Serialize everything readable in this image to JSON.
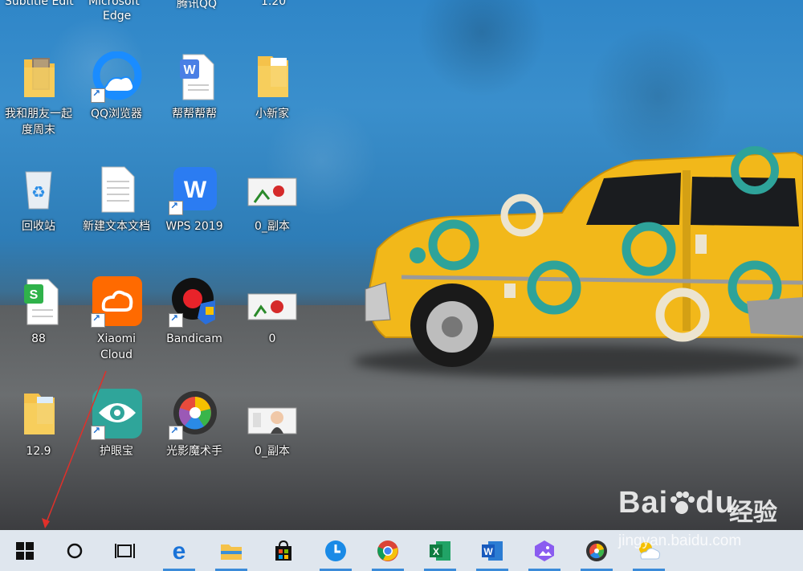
{
  "desktop": {
    "top_partial_labels": [
      "Subtitle Edit",
      "Microsoft",
      "Edge",
      "腾讯QQ",
      "1.20"
    ],
    "icons": [
      {
        "label": "我和朋友一起\n度周末",
        "name": "folder-photos-icon",
        "shortcut": false
      },
      {
        "label": "QQ浏览器",
        "name": "qq-browser-icon",
        "shortcut": true
      },
      {
        "label": "帮帮帮帮",
        "name": "wps-word-document-icon",
        "shortcut": false
      },
      {
        "label": "小新家",
        "name": "folder-document-icon",
        "shortcut": false
      },
      {
        "label": "回收站",
        "name": "recycle-bin-icon",
        "shortcut": false
      },
      {
        "label": "新建文本文档",
        "name": "text-document-icon",
        "shortcut": false
      },
      {
        "label": "WPS 2019",
        "name": "wps-office-icon",
        "shortcut": true
      },
      {
        "label": "0_副本",
        "name": "image-thumbnail-icon",
        "shortcut": false
      },
      {
        "label": "88",
        "name": "spreadsheet-document-icon",
        "shortcut": false
      },
      {
        "label": "Xiaomi\nCloud",
        "name": "xiaomi-cloud-icon",
        "shortcut": true
      },
      {
        "label": "Bandicam",
        "name": "bandicam-icon",
        "shortcut": true
      },
      {
        "label": "0",
        "name": "image-thumbnail-icon",
        "shortcut": false
      },
      {
        "label": "12.9",
        "name": "folder-document-icon",
        "shortcut": false
      },
      {
        "label": "护眼宝",
        "name": "eye-protection-icon",
        "shortcut": true
      },
      {
        "label": "光影魔术手",
        "name": "photo-editor-icon",
        "shortcut": true
      },
      {
        "label": "0_副本",
        "name": "portrait-thumbnail-icon",
        "shortcut": false
      }
    ]
  },
  "taskbar": {
    "items": [
      {
        "name": "start-button",
        "icon": "windows-logo-icon"
      },
      {
        "name": "search-button",
        "icon": "cortana-circle-icon"
      },
      {
        "name": "task-view-button",
        "icon": "task-view-icon"
      },
      {
        "name": "edge-taskbar-button",
        "icon": "edge-icon"
      },
      {
        "name": "file-explorer-taskbar-button",
        "icon": "folder-icon"
      },
      {
        "name": "store-taskbar-button",
        "icon": "store-icon"
      },
      {
        "name": "clock-app-taskbar-button",
        "icon": "clock-icon"
      },
      {
        "name": "chrome-taskbar-button",
        "icon": "chrome-icon"
      },
      {
        "name": "excel-taskbar-button",
        "icon": "excel-icon"
      },
      {
        "name": "word-taskbar-button",
        "icon": "word-icon"
      },
      {
        "name": "photos-taskbar-button",
        "icon": "photos-icon"
      },
      {
        "name": "photo-editor-taskbar-button",
        "icon": "photo-editor-icon"
      },
      {
        "name": "weather-taskbar-button",
        "icon": "weather-icon"
      }
    ]
  },
  "watermark": {
    "brand": "Bai",
    "brand2": "du",
    "cn": "经验",
    "url": "jingyan.baidu.com"
  },
  "colors": {
    "annotation_arrow": "#e0302a",
    "taskbar_bg": "#dfe6ee",
    "active_indicator": "#3b8bd9"
  }
}
